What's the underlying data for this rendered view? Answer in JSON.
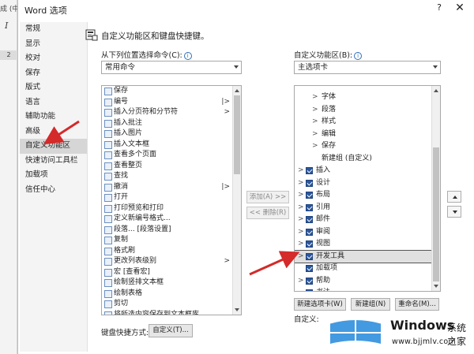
{
  "background": {
    "title_fragment": "成 (中",
    "italic_glyph": "I",
    "ruler_number": "2"
  },
  "dialog": {
    "title": "Word 选项",
    "help": "?",
    "close": "✕"
  },
  "nav": {
    "items": [
      {
        "label": "常规",
        "active": false
      },
      {
        "label": "显示",
        "active": false
      },
      {
        "label": "校对",
        "active": false
      },
      {
        "label": "保存",
        "active": false
      },
      {
        "label": "版式",
        "active": false
      },
      {
        "label": "语言",
        "active": false
      },
      {
        "label": "辅助功能",
        "active": false
      },
      {
        "label": "高级",
        "active": false
      },
      {
        "label": "自定义功能区",
        "active": true
      },
      {
        "label": "快速访问工具栏",
        "active": false
      },
      {
        "label": "加载项",
        "active": false
      },
      {
        "label": "信任中心",
        "active": false
      }
    ]
  },
  "header": {
    "text": "自定义功能区和键盘快捷键。",
    "icon": "customize-ribbon-icon"
  },
  "left_panel": {
    "label": "从下列位置选择命令(C):",
    "info": "i",
    "combo_value": "常用命令",
    "commands": [
      {
        "label": "保存",
        "sub": ""
      },
      {
        "label": "编号",
        "sub": "|>"
      },
      {
        "label": "插入分页符和分节符",
        "sub": ">"
      },
      {
        "label": "插入批注",
        "sub": ""
      },
      {
        "label": "插入图片",
        "sub": ""
      },
      {
        "label": "插入文本框",
        "sub": ""
      },
      {
        "label": "查看多个页面",
        "sub": ""
      },
      {
        "label": "查看整页",
        "sub": ""
      },
      {
        "label": "查找",
        "sub": ""
      },
      {
        "label": "撤消",
        "sub": "|>"
      },
      {
        "label": "打开",
        "sub": ""
      },
      {
        "label": "打印预览和打印",
        "sub": ""
      },
      {
        "label": "定义新编号格式...",
        "sub": ""
      },
      {
        "label": "段落... [段落设置]",
        "sub": ""
      },
      {
        "label": "复制",
        "sub": ""
      },
      {
        "label": "格式刷",
        "sub": ""
      },
      {
        "label": "更改列表级别",
        "sub": ">"
      },
      {
        "label": "宏 [查看宏]",
        "sub": ""
      },
      {
        "label": "绘制竖排文本框",
        "sub": ""
      },
      {
        "label": "绘制表格",
        "sub": ""
      },
      {
        "label": "剪切",
        "sub": ""
      },
      {
        "label": "将所选内容保存到文本框库",
        "sub": ""
      }
    ],
    "shortcut_label": "键盘快捷方式:",
    "customize_button": "自定义(T)..."
  },
  "middle": {
    "add": "添加(A) >>",
    "remove": "<< 删除(R)"
  },
  "right_panel": {
    "label": "自定义功能区(B):",
    "info": "i",
    "combo_value": "主选项卡",
    "tree": [
      {
        "label": "字体",
        "level": 2,
        "checkbox": false,
        "expander": ">"
      },
      {
        "label": "段落",
        "level": 2,
        "checkbox": false,
        "expander": ">"
      },
      {
        "label": "样式",
        "level": 2,
        "checkbox": false,
        "expander": ">"
      },
      {
        "label": "编辑",
        "level": 2,
        "checkbox": false,
        "expander": ">"
      },
      {
        "label": "保存",
        "level": 2,
        "checkbox": false,
        "expander": ">"
      },
      {
        "label": "新建组 (自定义)",
        "level": 2,
        "checkbox": false,
        "expander": ""
      },
      {
        "label": "插入",
        "level": 1,
        "checkbox": true,
        "expander": ">"
      },
      {
        "label": "设计",
        "level": 1,
        "checkbox": true,
        "expander": ">"
      },
      {
        "label": "布局",
        "level": 1,
        "checkbox": true,
        "expander": ">"
      },
      {
        "label": "引用",
        "level": 1,
        "checkbox": true,
        "expander": ">"
      },
      {
        "label": "邮件",
        "level": 1,
        "checkbox": true,
        "expander": ">"
      },
      {
        "label": "审阅",
        "level": 1,
        "checkbox": true,
        "expander": ">"
      },
      {
        "label": "视图",
        "level": 1,
        "checkbox": true,
        "expander": ">"
      },
      {
        "label": "开发工具",
        "level": 1,
        "checkbox": true,
        "expander": ">",
        "selected": true
      },
      {
        "label": "加载项",
        "level": 1,
        "checkbox": true,
        "expander": ""
      },
      {
        "label": "帮助",
        "level": 1,
        "checkbox": true,
        "expander": ">"
      },
      {
        "label": "书法",
        "level": 1,
        "checkbox": true,
        "expander": ""
      }
    ],
    "new_tab_button": "新建选项卡(W)",
    "new_group_button": "新建组(N)",
    "rename_button": "重命名(M)...",
    "customizations_label": "自定义:"
  },
  "watermark": {
    "brand": "Windows",
    "suffix": "系统之家",
    "url": "www.bjjmlv.com"
  },
  "colors": {
    "annotation_arrow": "#d42a2a",
    "checkbox": "#2b579a",
    "accent_blue": "#2f6fb9"
  }
}
